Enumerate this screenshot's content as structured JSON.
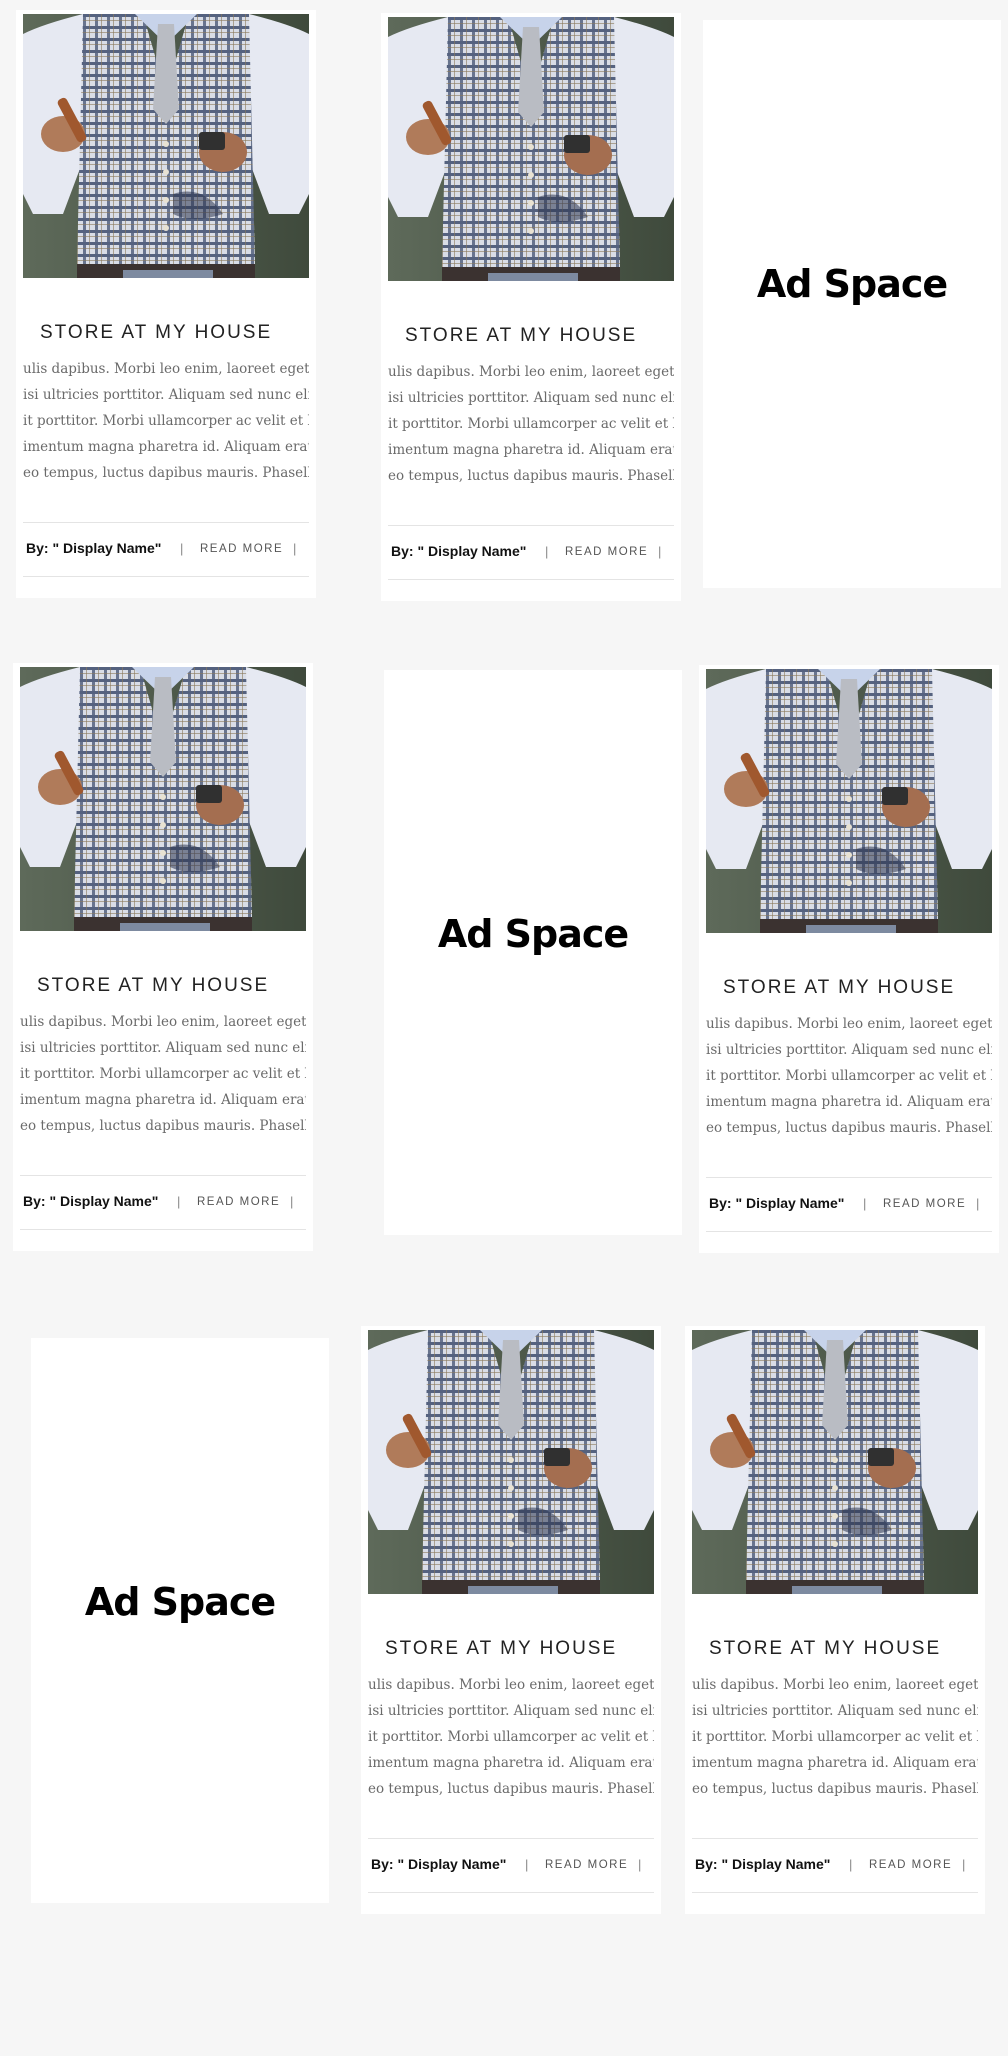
{
  "card": {
    "title": "STORE AT MY HOUSE",
    "excerpt_lines": [
      "ulis dapibus. Morbi leo enim, laoreet eget urr",
      "isi ultricies porttitor. Aliquam sed nunc elit. N",
      "it porttitor. Morbi ullamcorper ac velit et laor",
      "imentum magna pharetra id. Aliquam erat vo",
      "eo tempus, luctus dapibus mauris. Phasellus"
    ],
    "author": "By: \" Display Name\"",
    "separator": "|",
    "read_more": "READ MORE",
    "image_icon": "man-in-plaid-vest-photo"
  },
  "ad": {
    "label": "Ad Space"
  },
  "colors": {
    "page_bg": "#f6f6f6",
    "card_bg": "#ffffff",
    "title": "#222222",
    "excerpt": "#6a6a6a"
  }
}
